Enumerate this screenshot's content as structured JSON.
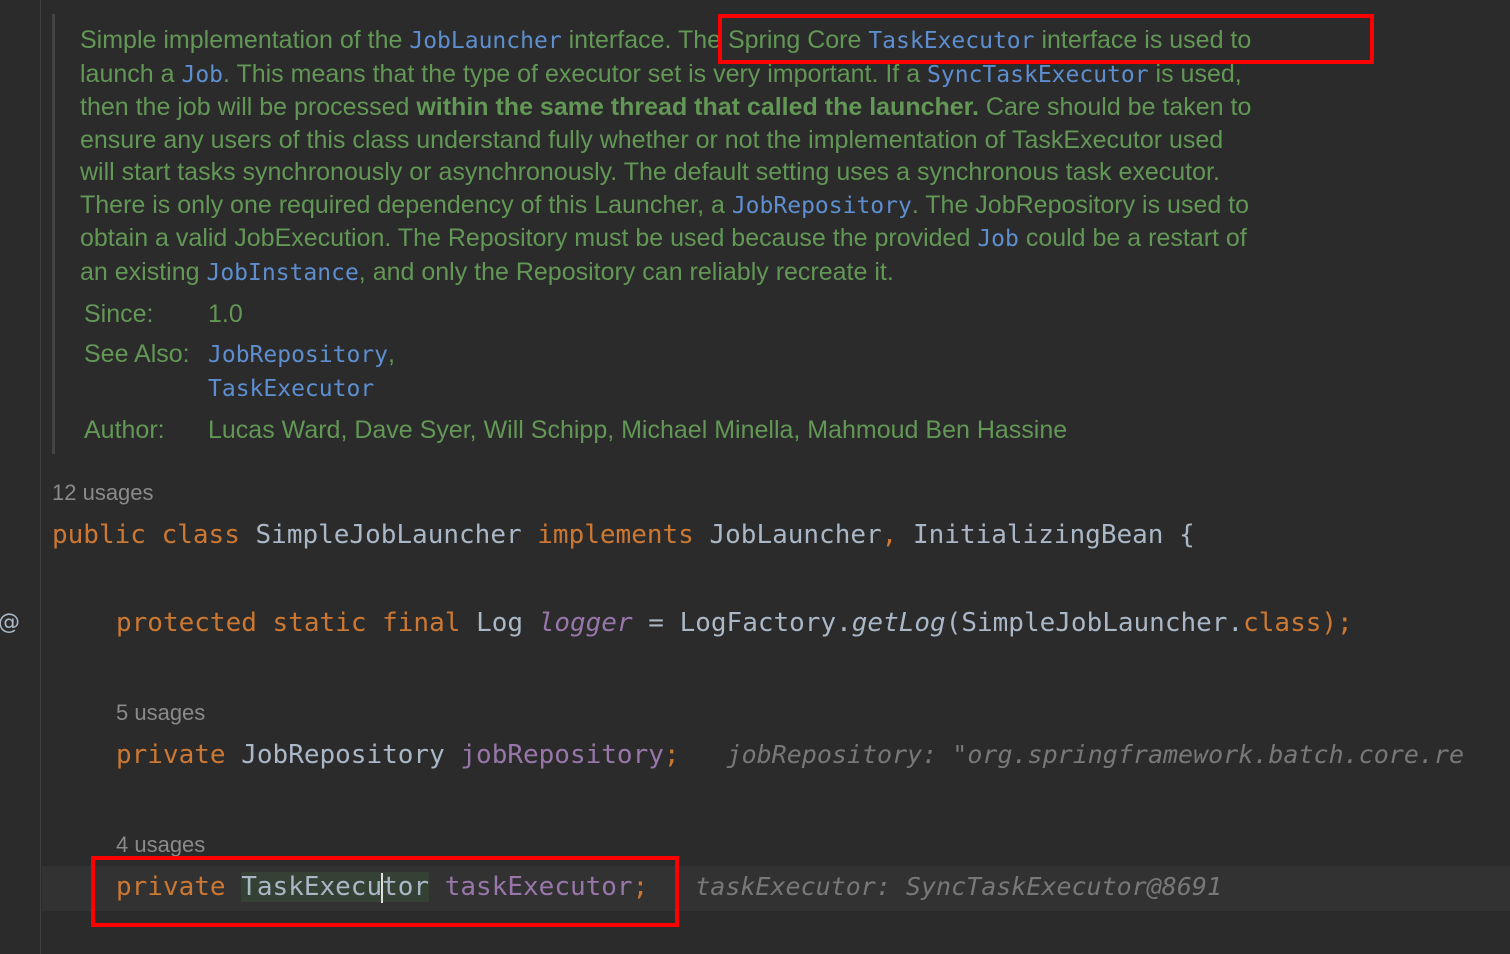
{
  "doc": {
    "line1": [
      "Simple implementation of the ",
      "JobLauncher",
      " interface. ",
      "The Spring Core ",
      "TaskExecutor",
      " interface is used to"
    ],
    "line2": [
      "launch a ",
      "Job",
      ". This means that the type of executor set is very important. If a ",
      "SyncTaskExecutor",
      " is used,"
    ],
    "line3": [
      "then the job will be processed ",
      "within the same thread that called the launcher.",
      " Care should be taken to"
    ],
    "line4": "ensure any users of this class understand fully whether or not the implementation of TaskExecutor used",
    "line5": "will start tasks synchronously or asynchronously. The default setting uses a synchronous task executor.",
    "line6": [
      "There is only one required dependency of this Launcher, a ",
      "JobRepository",
      ". The JobRepository is used to"
    ],
    "line7": [
      "obtain a valid JobExecution. The Repository must be used because the provided ",
      "Job",
      " could be a restart of"
    ],
    "line8": [
      "an existing ",
      "JobInstance",
      ", and only the Repository can reliably recreate it."
    ],
    "since_label": "Since:",
    "since_value": "1.0",
    "see_also_label": "See Also:",
    "see_also": [
      "JobRepository",
      ",",
      "TaskExecutor"
    ],
    "author_label": "Author:",
    "author_value": "Lucas Ward, Dave Syer, Will Schipp, Michael Minella, Mahmoud Ben Hassine"
  },
  "gutter": {
    "mark": "@"
  },
  "code": {
    "class_usages": "12 usages",
    "class_line": {
      "kw1": "public",
      "kw2": "class",
      "name": "SimpleJobLauncher",
      "kw3": "implements",
      "iface1": "JobLauncher",
      "comma": ",",
      "iface2": "InitializingBean",
      "brace": "{"
    },
    "logger_line": {
      "kw1": "protected",
      "kw2": "static",
      "kw3": "final",
      "type": "Log",
      "field": "logger",
      "eq": "=",
      "call_prefix": "LogFactory.",
      "method": "getLog",
      "arg": "(SimpleJobLauncher.",
      "cls": "class",
      "end": ");"
    },
    "repo_usages": "5 usages",
    "repo_line": {
      "kw": "private",
      "type": "JobRepository",
      "field": "jobRepository",
      "semi": ";",
      "hint": "jobRepository: \"org.springframework.batch.core.re"
    },
    "exec_usages": "4 usages",
    "exec_line": {
      "kw": "private",
      "type_a": "TaskExecu",
      "type_b": "tor",
      "field": "taskExecutor",
      "semi": ";",
      "hint": "taskExecutor: SyncTaskExecutor@8691"
    }
  }
}
